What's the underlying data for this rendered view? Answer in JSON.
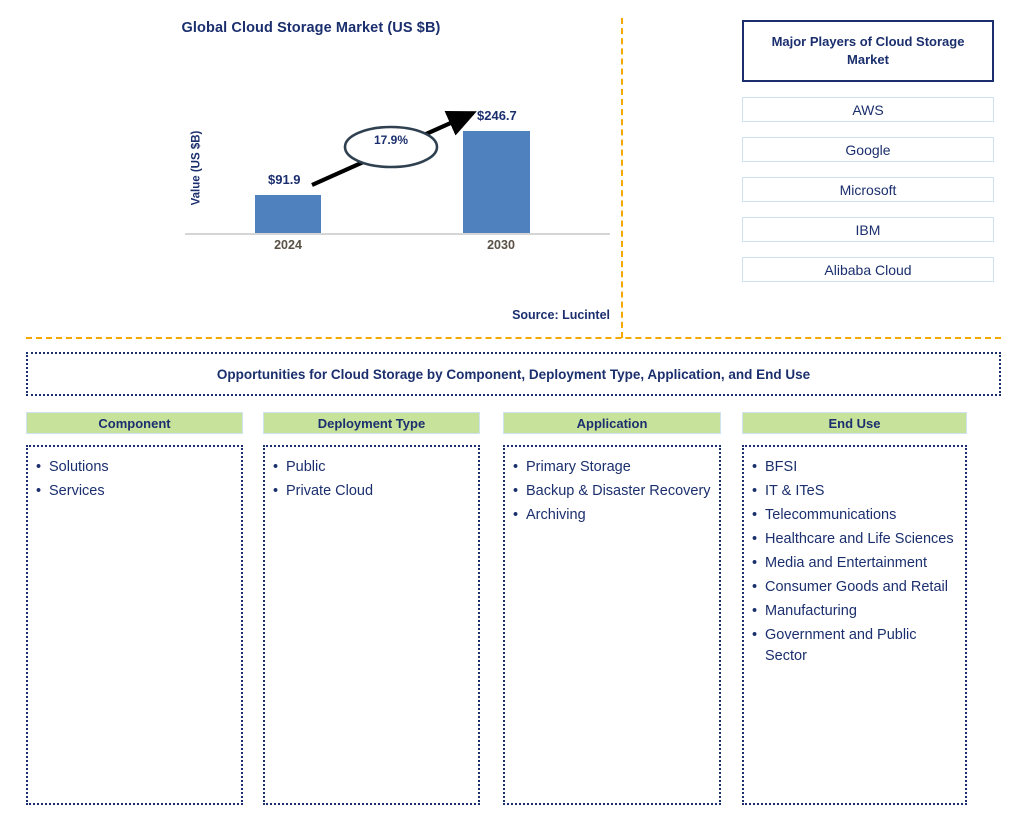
{
  "chart_panel": {
    "title": "Global Cloud Storage Market (US $B)",
    "source": "Source: Lucintel"
  },
  "chart_data": {
    "type": "bar",
    "title": "Global Cloud Storage Market (US $B)",
    "xlabel": "",
    "ylabel": "Value (US $B)",
    "categories": [
      "2024",
      "2030"
    ],
    "values": [
      91.9,
      246.7
    ],
    "value_labels": [
      "$91.9",
      "$246.7"
    ],
    "ylim": [
      0,
      270
    ],
    "grid": false,
    "legend": null,
    "bar_color": "#4e81bd",
    "annotations": [
      {
        "text": "17.9%",
        "kind": "cagr-ellipse-arrow",
        "from_category": "2024",
        "to_category": "2030"
      }
    ],
    "source": "Source: Lucintel"
  },
  "players": {
    "header": "Major Players of Cloud Storage Market",
    "items": [
      {
        "label": "AWS"
      },
      {
        "label": "Google"
      },
      {
        "label": "Microsoft"
      },
      {
        "label": "IBM"
      },
      {
        "label": "Alibaba Cloud"
      }
    ]
  },
  "opportunities": {
    "banner": "Opportunities for Cloud Storage by Component, Deployment Type, Application, and End Use",
    "columns": [
      {
        "header": "Component",
        "items": [
          "Solutions",
          "Services"
        ]
      },
      {
        "header": "Deployment Type",
        "items": [
          "Public",
          "Private Cloud"
        ]
      },
      {
        "header": "Application",
        "items": [
          "Primary Storage",
          "Backup & Disaster Recovery",
          "Archiving"
        ]
      },
      {
        "header": "End Use",
        "items": [
          "BFSI",
          "IT & ITeS",
          "Telecommunications",
          "Healthcare and Life Sciences",
          "Media and Entertainment",
          "Consumer Goods and Retail",
          "Manufacturing",
          "Government and Public Sector"
        ]
      }
    ]
  },
  "colors": {
    "navy": "#1b2f6e",
    "bar_blue": "#4e81bd",
    "header_green": "#c7e29a",
    "divider_amber": "#f5a800",
    "tick_gray": "#595146"
  }
}
